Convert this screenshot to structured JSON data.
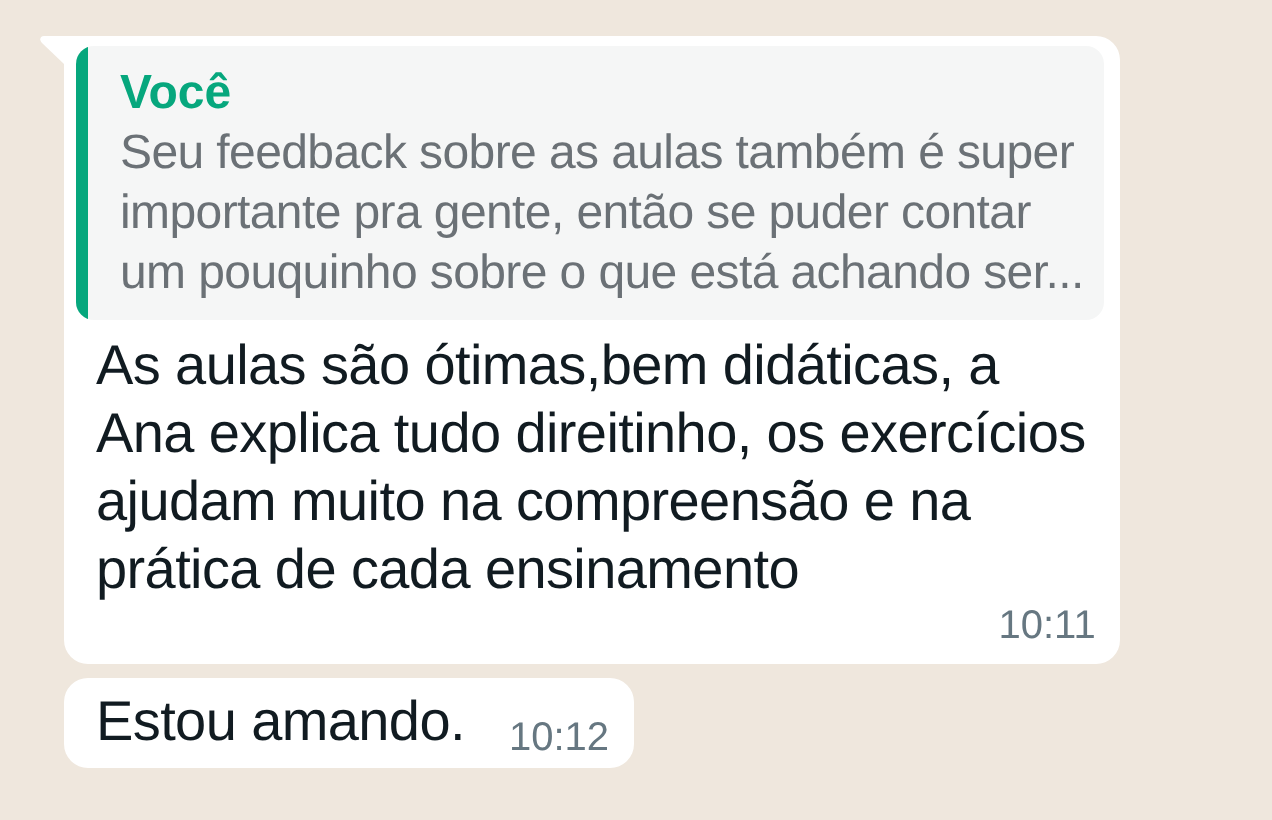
{
  "messages": [
    {
      "quote": {
        "author": "Você",
        "lines": [
          "Seu feedback sobre as aulas também é super",
          "importante pra gente, então se puder contar",
          "um pouquinho sobre o que está achando ser..."
        ]
      },
      "lines": [
        "As aulas são ótimas,bem didáticas, a",
        "Ana explica tudo direitinho, os exercícios",
        "ajudam muito na compreensão e na",
        "prática de cada ensinamento"
      ],
      "time": "10:11",
      "tail": true
    },
    {
      "lines": [
        "Estou amando."
      ],
      "time": "10:12",
      "tail": false
    }
  ]
}
